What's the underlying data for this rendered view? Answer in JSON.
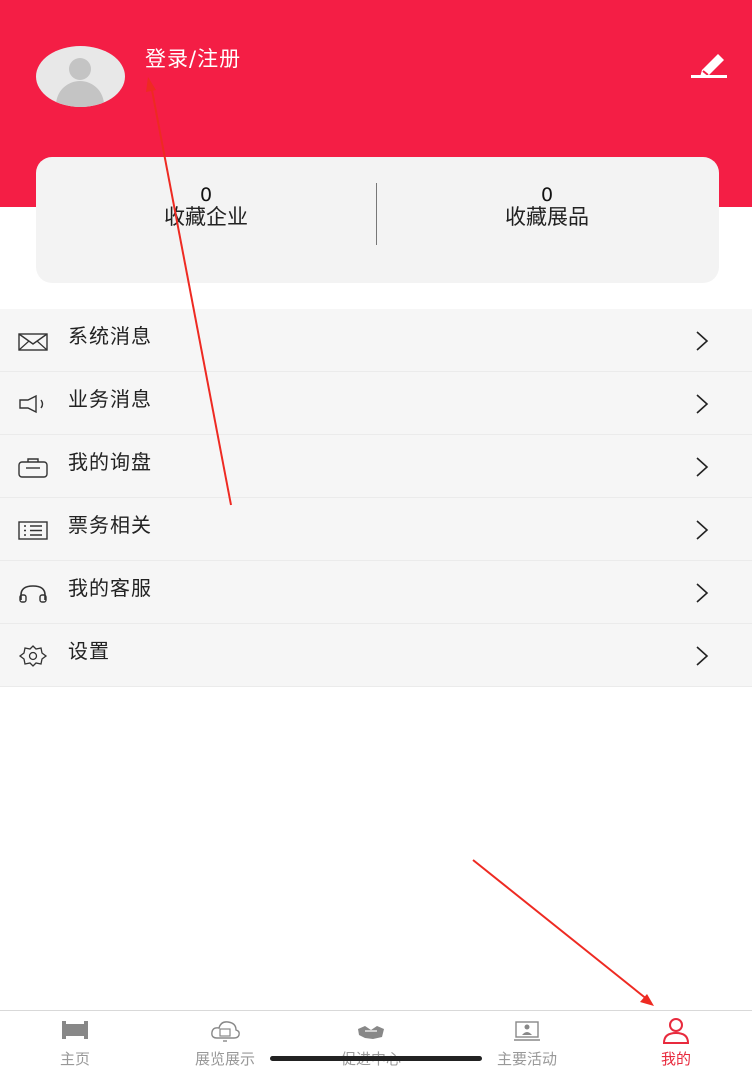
{
  "header": {
    "login_label": "登录/注册",
    "bg_color": "#f41e45",
    "edit_icon": "edit-pencil-icon"
  },
  "stats": {
    "favorite_companies": {
      "count": "0",
      "label": "收藏企业"
    },
    "favorite_exhibits": {
      "count": "0",
      "label": "收藏展品"
    }
  },
  "menu": {
    "items": [
      {
        "label": "系统消息",
        "icon": "envelope-icon"
      },
      {
        "label": "业务消息",
        "icon": "megaphone-icon"
      },
      {
        "label": "我的询盘",
        "icon": "briefcase-icon"
      },
      {
        "label": "票务相关",
        "icon": "ticket-list-icon"
      },
      {
        "label": "我的客服",
        "icon": "headset-icon"
      },
      {
        "label": "设置",
        "icon": "gear-icon"
      }
    ],
    "chevron_icon": "chevron-right-icon"
  },
  "tabbar": {
    "tabs": [
      {
        "label": "主页",
        "icon": "home-icon",
        "active": false
      },
      {
        "label": "展览展示",
        "icon": "cloud-display-icon",
        "active": false
      },
      {
        "label": "促进中心",
        "icon": "handshake-icon",
        "active": false
      },
      {
        "label": "主要活动",
        "icon": "presentation-icon",
        "active": false
      },
      {
        "label": "我的",
        "icon": "user-icon",
        "active": true
      }
    ],
    "active_color": "#e82a3d",
    "inactive_color": "#999999"
  },
  "annotation_color": "#ee2a22"
}
